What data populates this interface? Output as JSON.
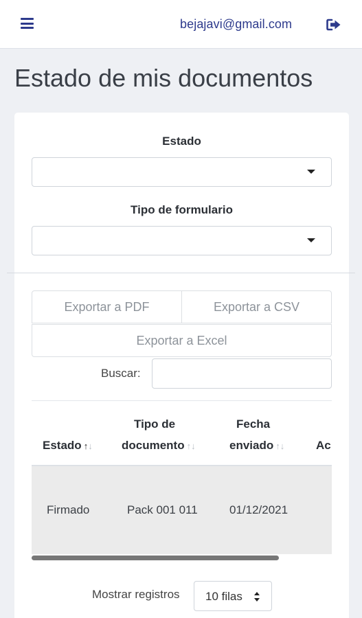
{
  "header": {
    "email": "bejajavi@gmail.com",
    "menu_icon": "hamburger-menu-icon",
    "logout_icon": "sign-out-icon"
  },
  "page": {
    "title": "Estado de mis documentos"
  },
  "filters": {
    "estado_label": "Estado",
    "estado_value": "",
    "tipo_label": "Tipo de formulario",
    "tipo_value": ""
  },
  "export": {
    "pdf": "Exportar a PDF",
    "csv": "Exportar a CSV",
    "excel": "Exportar a Excel"
  },
  "search": {
    "label": "Buscar:",
    "value": ""
  },
  "table": {
    "headers": {
      "estado": "Estado",
      "tipo_line1": "Tipo de",
      "tipo_line2": "documento",
      "fecha_line1": "Fecha",
      "fecha_line2": "enviado",
      "acciones": "Ac"
    },
    "rows": [
      {
        "estado": "Firmado",
        "tipo": "Pack 001 011",
        "fecha": "01/12/2021",
        "acciones": ""
      }
    ]
  },
  "length": {
    "label": "Mostrar registros",
    "value": "10 filas"
  },
  "colors": {
    "accent": "#2d3a8c",
    "background": "#eef0f4",
    "row_highlight": "#ebebeb"
  }
}
